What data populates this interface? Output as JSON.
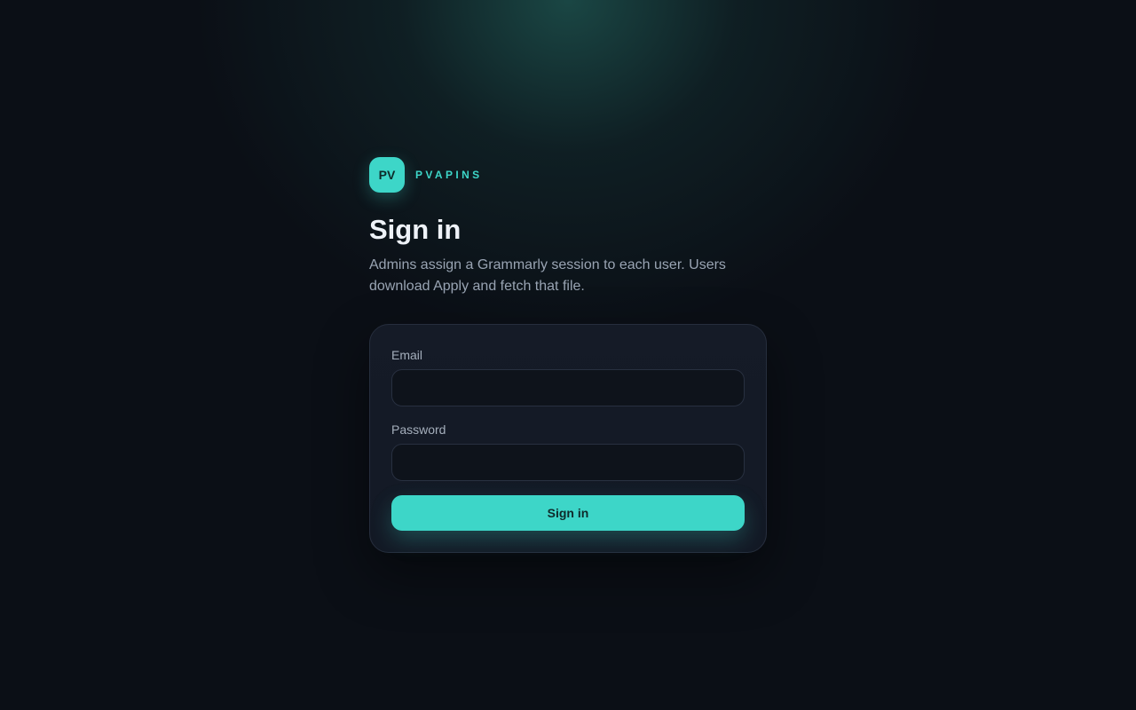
{
  "brand": {
    "logo_text": "PV",
    "name": "PVAPINS"
  },
  "heading": {
    "title": "Sign in",
    "subtitle": "Admins assign a Grammarly session to each user. Users download Apply and fetch that file."
  },
  "form": {
    "email_label": "Email",
    "email_value": "",
    "password_label": "Password",
    "password_value": "",
    "submit_label": "Sign in"
  },
  "colors": {
    "accent": "#3dd6c8",
    "background": "#0b0f16",
    "card": "#141a26"
  }
}
